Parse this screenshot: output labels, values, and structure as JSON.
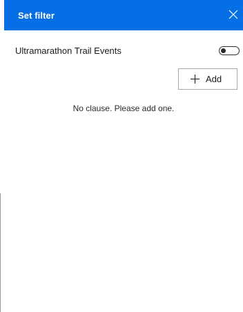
{
  "dialog": {
    "title": "Set filter",
    "close_icon": "close-icon",
    "header_color": "#076FE5"
  },
  "layer": {
    "name": "Ultramarathon Trail Events",
    "toggle_on": false
  },
  "actions": {
    "add_label": "Add",
    "add_icon": "plus-icon"
  },
  "clauses": {
    "empty_message": "No clause. Please add one."
  }
}
